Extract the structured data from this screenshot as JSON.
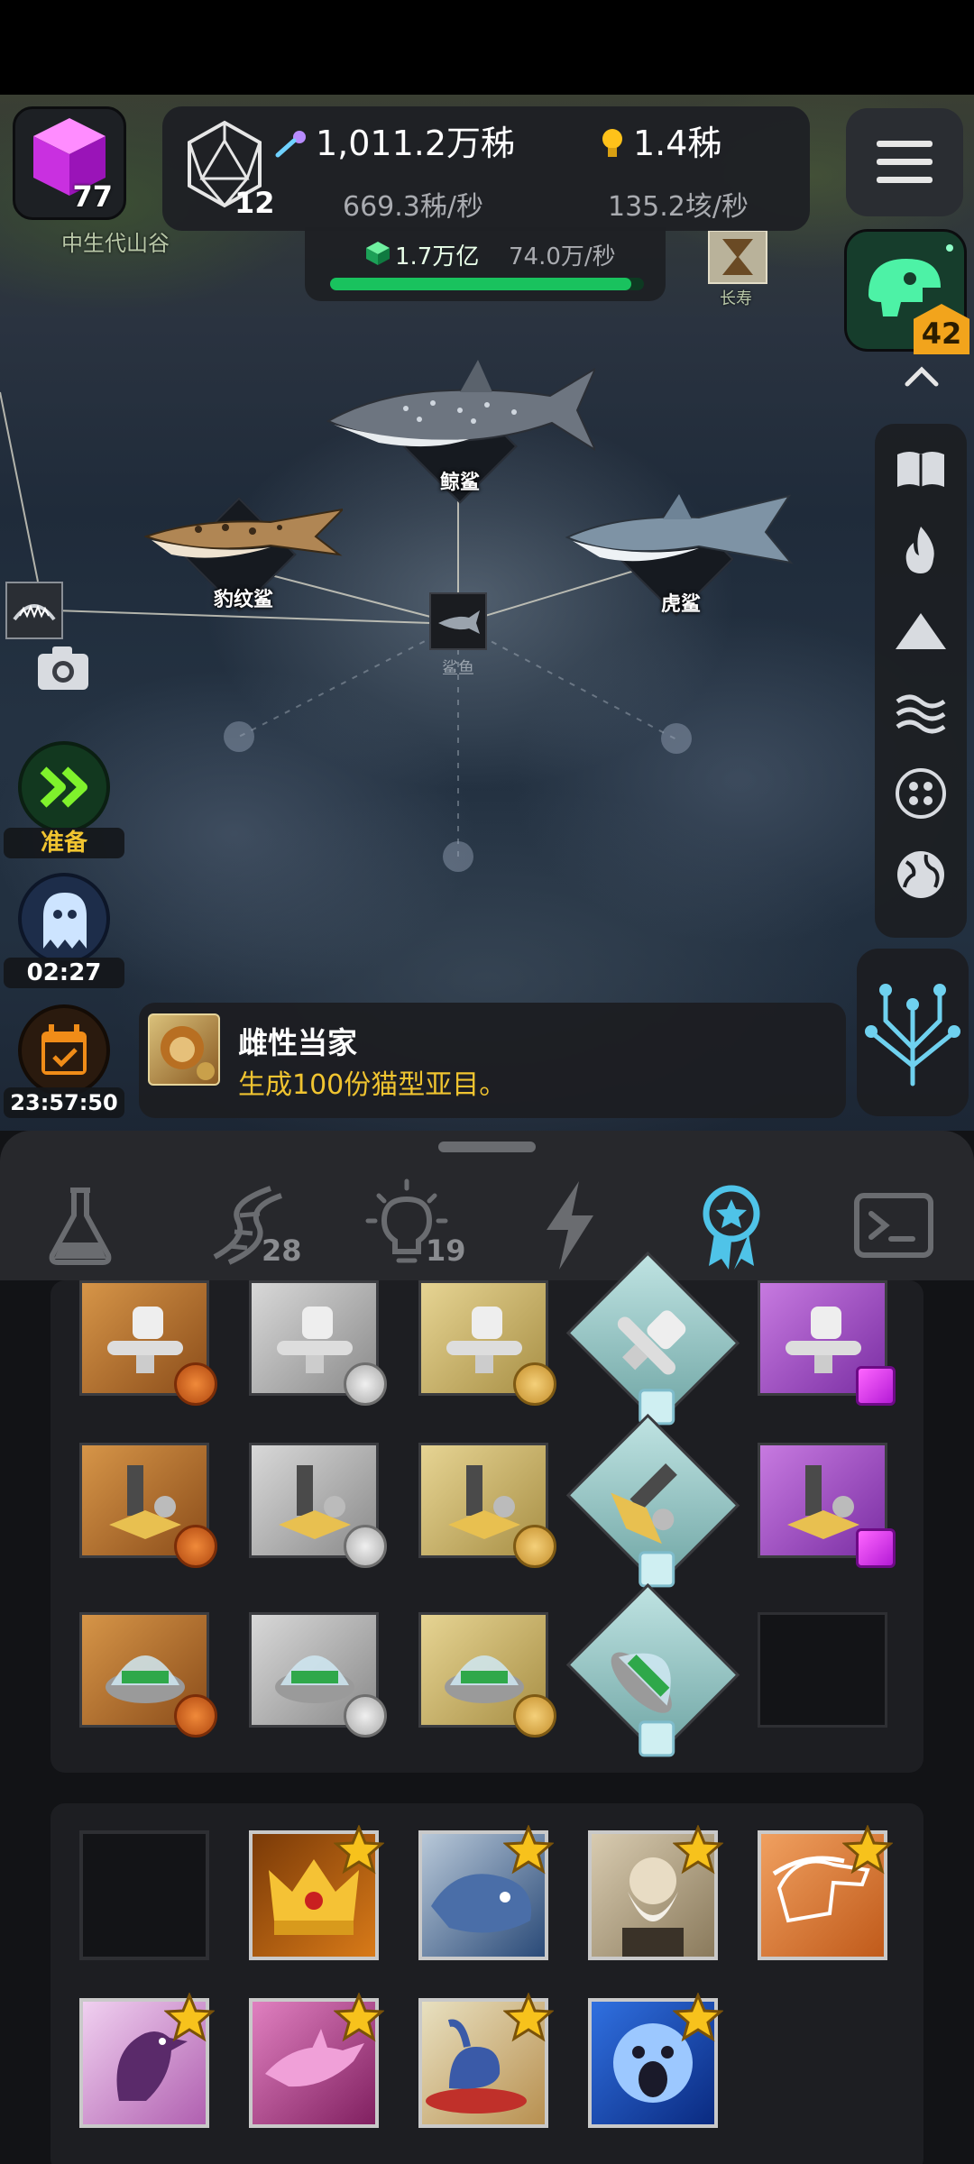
{
  "hud": {
    "gem_count": "77",
    "d20_count": "12",
    "resource_main": "1,011.2万秭",
    "resource_main_rate": "669.3秭/秒",
    "idea_main": "1.4秭",
    "idea_rate": "135.2垓/秒",
    "sub_value": "1.7万亿",
    "sub_rate": "74.0万/秒",
    "sub_progress": 0.96,
    "dino_badge": "42"
  },
  "map": {
    "region_label": "中生代山谷",
    "region_label_right": "长寿",
    "nodes": {
      "whale_shark": "鲸鲨",
      "leopard_shark": "豹纹鲨",
      "tiger_shark": "虎鲨",
      "shark": "鲨鱼"
    }
  },
  "left": {
    "ready_label": "准备",
    "timer_label": "02:27",
    "daily_label": "23:57:50"
  },
  "quest": {
    "title": "雌性当家",
    "desc": "生成100份猫型亚目。"
  },
  "tabs": [
    {
      "name": "research",
      "icon": "flask-icon",
      "count": ""
    },
    {
      "name": "dna",
      "icon": "dna-icon",
      "count": "28"
    },
    {
      "name": "ideas",
      "icon": "lightbulb-icon",
      "count": "19"
    },
    {
      "name": "energy",
      "icon": "lightning-icon",
      "count": ""
    },
    {
      "name": "achievements",
      "icon": "award-icon",
      "count": ""
    },
    {
      "name": "console",
      "icon": "terminal-icon",
      "count": ""
    }
  ],
  "colors": {
    "accent_green": "#19c25e",
    "active_tab": "#4fc3e8",
    "quest_desc": "#f0c430"
  }
}
